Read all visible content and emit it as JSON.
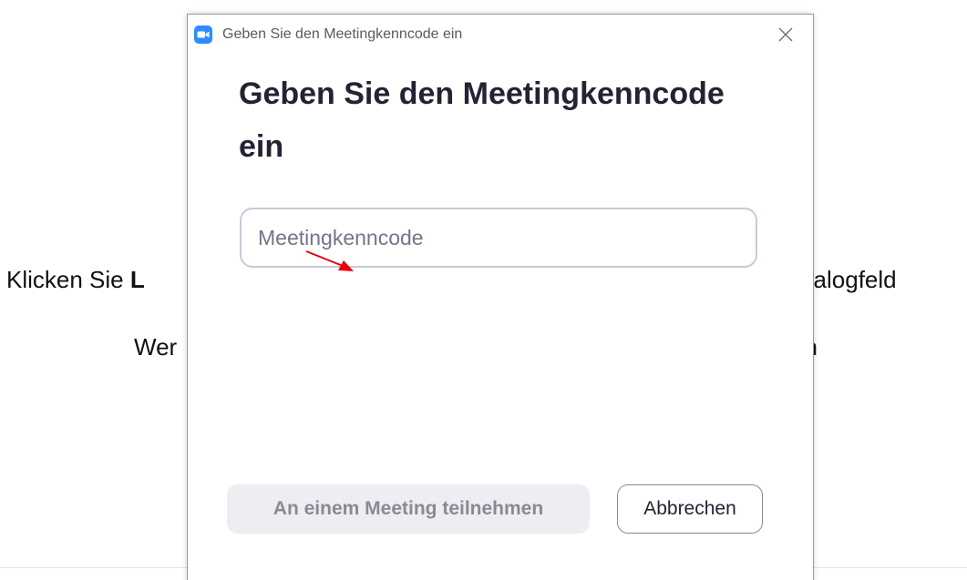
{
  "background": {
    "line1_left_prefix": "Klicken Sie ",
    "line1_left_bold": "L",
    "line1_right": "Dialogfeld",
    "line2_left": "Wer",
    "line2_right": "en"
  },
  "dialog": {
    "window_title": "Geben Sie den Meetingkenncode ein",
    "app_icon": "zoom-video-camera-icon",
    "close_icon": "close-x-icon",
    "heading": "Geben Sie den Meetingkenncode ein",
    "passcode_input": {
      "value": "",
      "placeholder": "Meetingkenncode"
    },
    "join_button_label": "An einem Meeting teilnehmen",
    "cancel_button_label": "Abbrechen"
  },
  "colors": {
    "zoom_blue": "#2d8cff",
    "annotation_arrow": "#e8000b",
    "heading_text": "#232333",
    "disabled_button_bg": "#ededf2"
  }
}
